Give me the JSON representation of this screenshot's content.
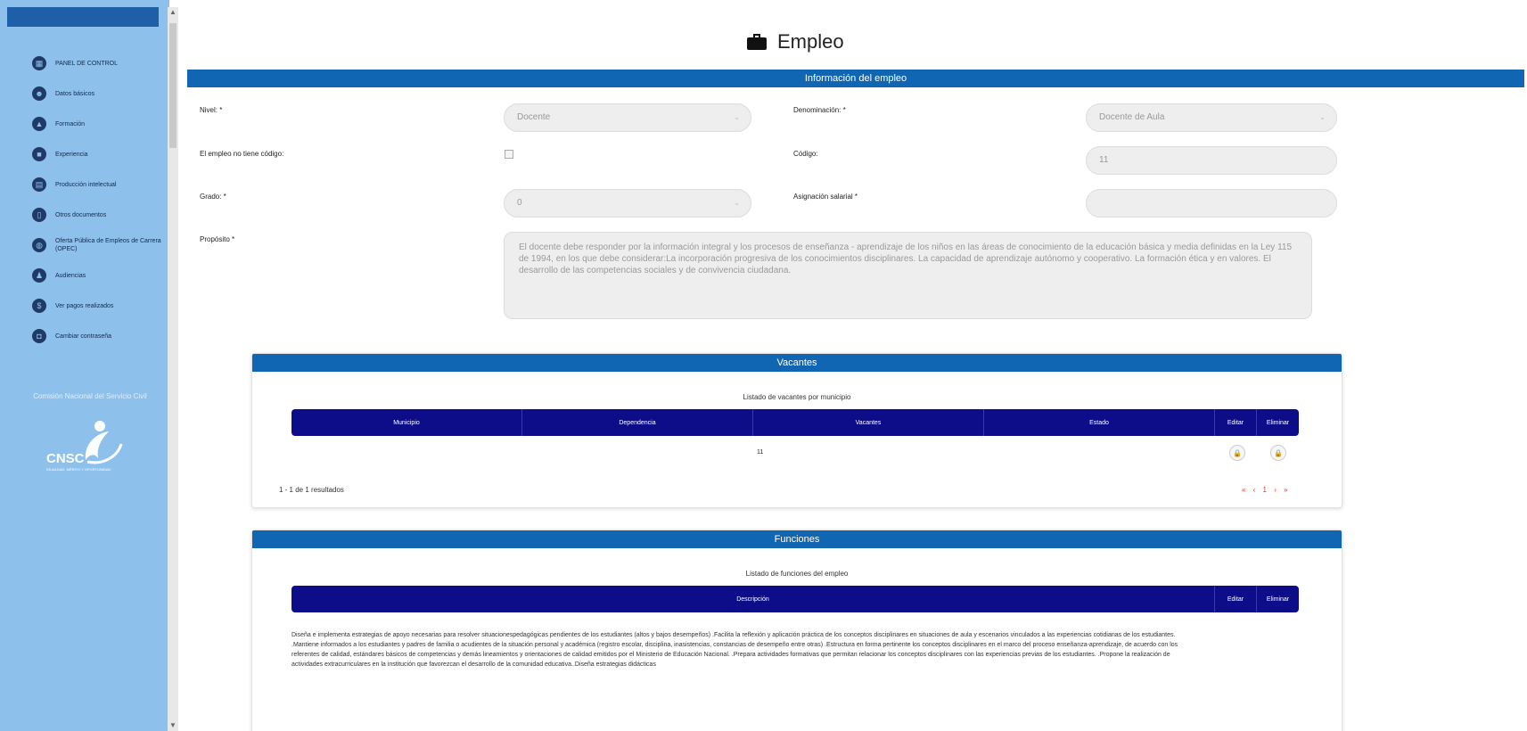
{
  "sidebar": {
    "items": [
      {
        "label": "PANEL DE CONTROL",
        "icon": "dashboard-icon"
      },
      {
        "label": "Datos básicos",
        "icon": "users-icon"
      },
      {
        "label": "Formación",
        "icon": "graduation-icon"
      },
      {
        "label": "Experiencia",
        "icon": "briefcase-icon"
      },
      {
        "label": "Producción intelectual",
        "icon": "book-icon"
      },
      {
        "label": "Otros documentos",
        "icon": "document-icon"
      },
      {
        "label": "Oferta Pública de Empleos de Carrera (OPEC)",
        "icon": "globe-icon"
      },
      {
        "label": "Audiencias",
        "icon": "audience-icon"
      },
      {
        "label": "Ver pagos realizados",
        "icon": "dollar-icon"
      },
      {
        "label": "Cambiar contraseña",
        "icon": "lock-icon"
      }
    ],
    "logo": {
      "org_name": "Comisión Nacional del Servicio Civil",
      "acronym": "CNSC",
      "tagline": "IGUALDAD, MÉRITO Y OPORTUNIDAD"
    }
  },
  "page": {
    "title": "Empleo",
    "icon": "briefcase-icon"
  },
  "info_panel": {
    "header": "Información del empleo",
    "fields": {
      "nivel_label": "Nivel: *",
      "nivel_value": "Docente",
      "denominacion_label": "Denominación: *",
      "denominacion_value": "Docente de Aula",
      "sin_codigo_label": "El empleo no tiene código:",
      "codigo_label": "Código:",
      "codigo_value": "11",
      "grado_label": "Grado: *",
      "grado_value": "0",
      "asignacion_label": "Asignación salarial *",
      "asignacion_value": "",
      "proposito_label": "Propósito *",
      "proposito_value": "El docente debe responder por la información integral y los procesos de enseñanza - aprendizaje de los niños en las áreas de conocimiento de la educación básica y media definidas en la Ley 115 de 1994, en los que debe considerar:La incorporación progresiva de los conocimientos disciplinares. La capacidad de aprendizaje autónomo y cooperativo. La formación ética y en valores. El desarrollo de las competencias sociales y de convivencia ciudadana."
    }
  },
  "vacantes": {
    "header": "Vacantes",
    "caption": "Listado de vacantes por municipio",
    "columns": [
      "Municipio",
      "Dependencia",
      "Vacantes",
      "Estado",
      "Editar",
      "Eliminar"
    ],
    "rows": [
      {
        "municipio": "",
        "dependencia": "",
        "vacantes": "11",
        "estado": ""
      }
    ],
    "results": "1 - 1 de 1 resultados",
    "pager": "« ‹ 1 › »"
  },
  "funciones": {
    "header": "Funciones",
    "caption": "Listado de funciones del empleo",
    "columns": [
      "Descripción",
      "Editar",
      "Eliminar"
    ],
    "description": "Diseña e implementa estrategias de apoyo necesarias para resolver situacionespedagógicas pendientes de los estudiantes (altos y bajos desempeños) .Facilita la reflexión y aplicación práctica de los conceptos disciplinares en situaciones de aula y escenarios vinculados a las experiencias cotidianas de los estudiantes. .Mantiene informados a los estudiantes y padres de familia o acudientes de la situación personal y académica (registro escolar, disciplina, inasistencias, constancias de desempeño entre otras) .Estructura en forma pertinente los conceptos disciplinares en el marco del proceso enseñanza-aprendizaje, de acuerdo con los referentes de calidad, estándares básicos de competencias y demás lineamientos y orientaciones de calidad emitidos por el Ministerio de Educación Nacional. .Prepara actividades formativas que permitan relacionar los conceptos disciplinares con las experiencias previas de los estudiantes. .Propone la realización de actividades extracurriculares en la institución que favorezcan el desarrollo de la comunidad educativa..Diseña estrategias didácticas"
  },
  "colors": {
    "sidebar_bg": "#8ec0ec",
    "panel_header": "#1166b3",
    "table_header": "#0d0d8a",
    "pager": "#e03030"
  }
}
